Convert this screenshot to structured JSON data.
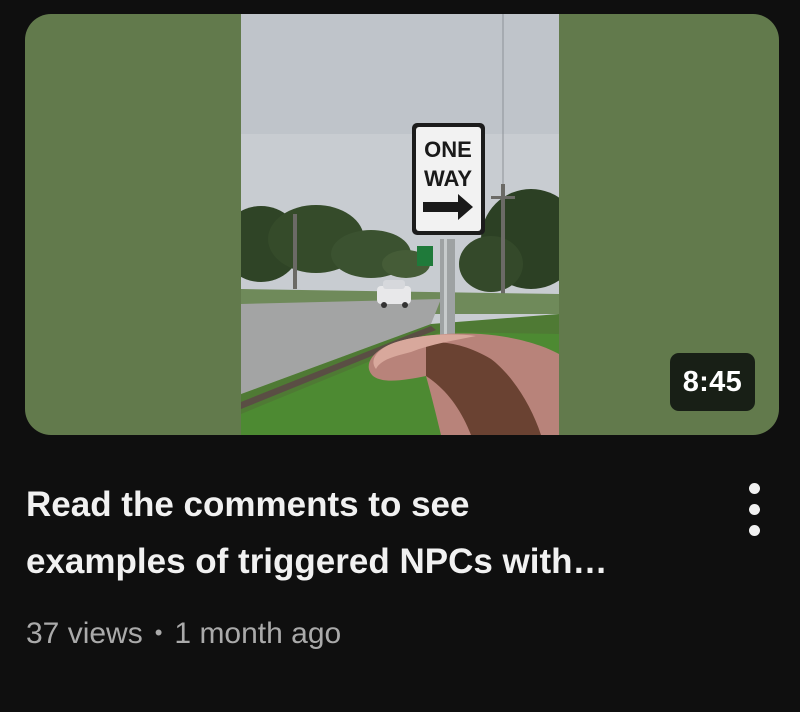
{
  "video": {
    "duration": "8:45",
    "title_line1": "Read the comments to see",
    "title_line2": "examples of triggered NPCs with…",
    "views": "37 views",
    "separator": "•",
    "age": "1 month ago"
  },
  "thumbnail": {
    "sign_line1": "ONE",
    "sign_line2": "WAY"
  },
  "icons": {
    "menu": "more-vert-icon"
  },
  "colors": {
    "background": "#0f0f0f",
    "thumbnail_side": "#627a4c",
    "title": "#f1f1f1",
    "meta": "#aaaaaa"
  }
}
